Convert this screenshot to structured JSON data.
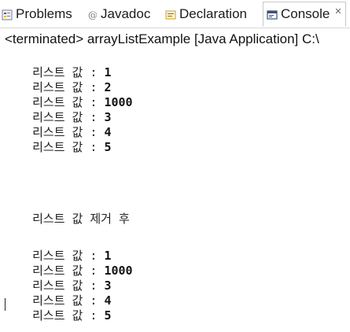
{
  "tabs": [
    {
      "label": "Problems",
      "icon": "problems-icon"
    },
    {
      "label": "Javadoc",
      "icon": "javadoc-icon"
    },
    {
      "label": "Declaration",
      "icon": "declaration-icon"
    },
    {
      "label": "Console",
      "icon": "console-icon",
      "active": true
    }
  ],
  "close_glyph": "✕",
  "console": {
    "header": "<terminated> arrayListExample [Java Application] C:\\",
    "lines_before": [
      {
        "label": "리스트 값 : ",
        "value": "1"
      },
      {
        "label": "리스트 값 : ",
        "value": "2"
      },
      {
        "label": "리스트 값 : ",
        "value": "1000"
      },
      {
        "label": "리스트 값 : ",
        "value": "3"
      },
      {
        "label": "리스트 값 : ",
        "value": "4"
      },
      {
        "label": "리스트 값 : ",
        "value": "5"
      }
    ],
    "separator": "리스트 값 제거 후",
    "lines_after": [
      {
        "label": "리스트 값 : ",
        "value": "1"
      },
      {
        "label": "리스트 값 : ",
        "value": "1000"
      },
      {
        "label": "리스트 값 : ",
        "value": "3"
      },
      {
        "label": "리스트 값 : ",
        "value": "4"
      },
      {
        "label": "리스트 값 : ",
        "value": "5"
      }
    ]
  },
  "colors": {
    "tab_border": "#c8c8c8",
    "text": "#111111"
  }
}
